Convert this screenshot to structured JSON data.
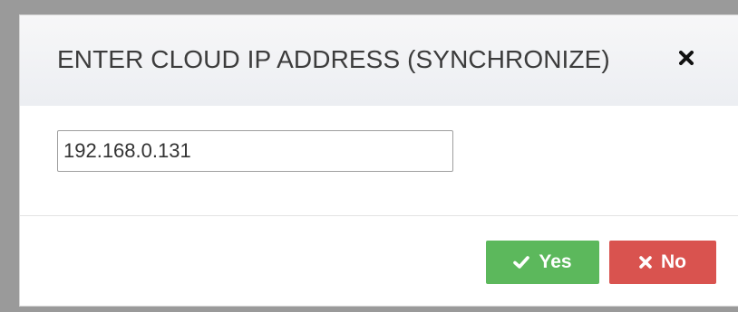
{
  "dialog": {
    "title": "ENTER CLOUD IP ADDRESS (SYNCHRONIZE)",
    "close_icon": "close-icon"
  },
  "form": {
    "ip_value": "192.168.0.131"
  },
  "actions": {
    "yes_label": "Yes",
    "yes_icon": "check-icon",
    "yes_color": "#5cb85c",
    "no_label": "No",
    "no_icon": "x-icon",
    "no_color": "#d9534f"
  }
}
